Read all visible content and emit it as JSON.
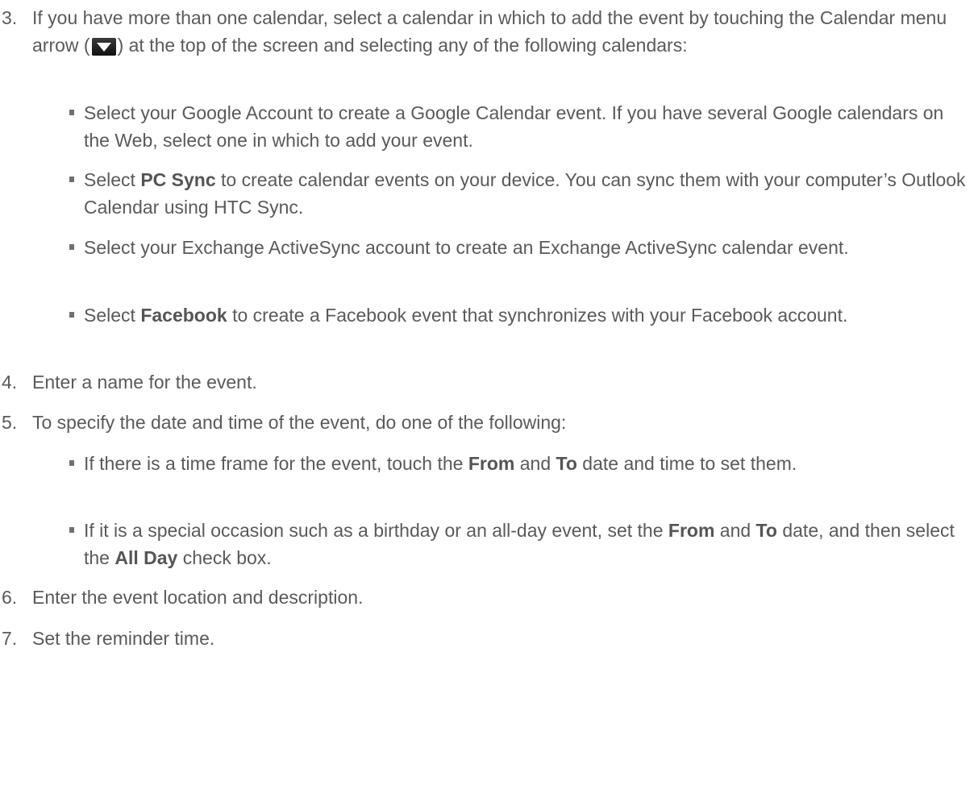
{
  "steps": {
    "s3": {
      "num": "3.",
      "p1": "If you have more than one calendar, select a calendar in which to add the event by touching the Calendar menu arrow (",
      "p2": ") at the top of the screen and selecting any of the following calendars:"
    },
    "s4": {
      "num": "4.",
      "text": "Enter a name for the event."
    },
    "s5": {
      "num": "5.",
      "text": "To specify the date and time of the event, do one of the following:"
    },
    "s6": {
      "num": "6.",
      "text": "Enter the event location and description."
    },
    "s7": {
      "num": "7.",
      "text": "Set the reminder time."
    }
  },
  "bullets": {
    "b1": {
      "text": "Select your Google Account to create a Google Calendar event. If you have several Google calendars on the Web, select one in which to add your event."
    },
    "b2": {
      "pre": "Select ",
      "bold": "PC Sync",
      "post": " to create calendar events on your device. You can sync them with your computer’s Outlook Calendar using HTC Sync."
    },
    "b3": {
      "text": "Select your Exchange ActiveSync account to create an Exchange ActiveSync calendar event."
    },
    "b4": {
      "pre": "Select ",
      "bold": "Facebook",
      "post": " to create a Facebook event that synchronizes with your Facebook account."
    },
    "b5": {
      "t1": "If there is a time frame for the event, touch the ",
      "bold1": "From",
      "t2": " and ",
      "bold2": "To",
      "t3": " date and time to set them."
    },
    "b6": {
      "t1": "If it is a special occasion such as a birthday or an all-day event, set the ",
      "bold1": "From",
      "t2": " and ",
      "bold2": "To",
      "t3": " date, and then select the ",
      "bold3": "All Day",
      "t4": " check box."
    }
  },
  "icons": {
    "calendar_menu_arrow": "chevron-down-icon"
  },
  "colors": {
    "text": "#5a5a5a",
    "bullet": "#707070",
    "icon_bg": "#1a1a1a"
  }
}
